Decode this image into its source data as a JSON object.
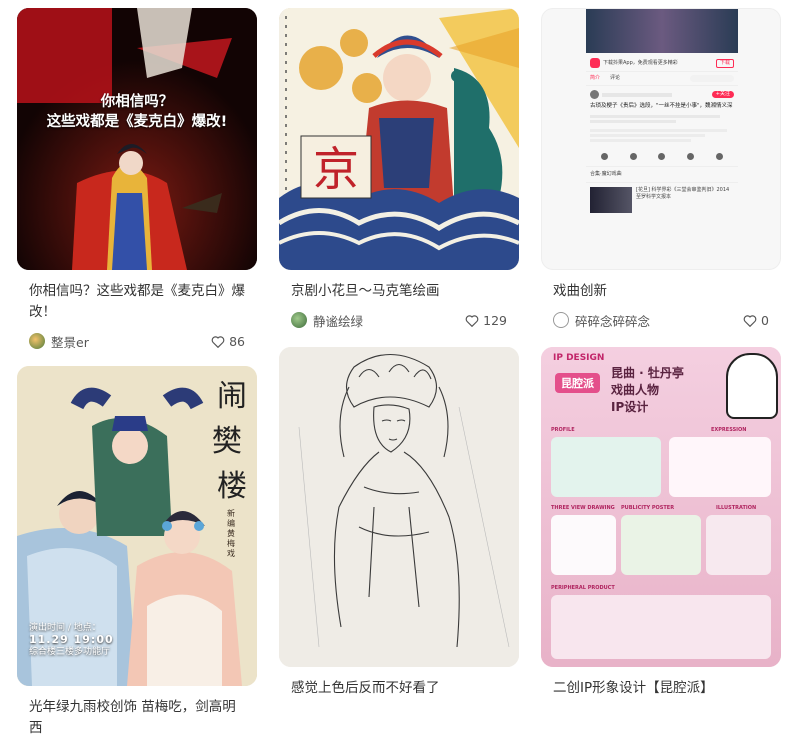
{
  "cards": [
    {
      "title": "你相信吗？这些戏都是《麦克白》爆改！",
      "overlay_line1": "你相信吗？",
      "overlay_line2": "这些戏都是《麦克白》爆改!",
      "author": "整景er",
      "likes": "86"
    },
    {
      "title": "京剧小花旦～马克笔绘画",
      "badge": "京",
      "author": "静谧绘绿",
      "likes": "129"
    },
    {
      "title": "戏曲创新",
      "author": "碎碎念碎碎念",
      "likes": "0",
      "shot": {
        "banner": "下载抖果App，免费观看更多精彩",
        "open": "下载",
        "tab1": "简介",
        "tab2": "评论",
        "follow": "+关注",
        "video_title": "古琐及梗子《贵后》选段，\"一丝不挂是小事\"，魏湘情义深",
        "collection": "合集·魔幻戏曲",
        "next_title": "[花旦] 科学界彩《三堂会审鉴判旧》2014至罗科学文报本"
      }
    },
    {
      "title": "光年绿九雨校创饰 苗梅吃，剑高明西",
      "poster_title": "闹樊楼",
      "poster_sub": "新编黄梅戏小戏",
      "time_label": "演出时间 / 地点：",
      "time": "11.29 19:00",
      "place": "综合楼三楼多功能厅"
    },
    {
      "title": "感觉上色后反而不好看了"
    },
    {
      "title": "二创IP形象设计【昆腔派】",
      "ip_en": "IP DESIGN",
      "ip_brand": "昆腔派",
      "ip_l1": "昆曲 · 牡丹亭",
      "ip_l2": "戏曲人物",
      "ip_l3": "IP设计",
      "sec1": "PROFILE",
      "sec2": "EXPRESSION",
      "sec3": "THREE VIEW DRAWING",
      "sec4": "PUBLICITY POSTER",
      "sec5": "ILLUSTRATION",
      "sec6": "PERIPHERAL PRODUCT"
    }
  ],
  "colors": {
    "accent": "#fe2c55",
    "like": "#555555"
  }
}
